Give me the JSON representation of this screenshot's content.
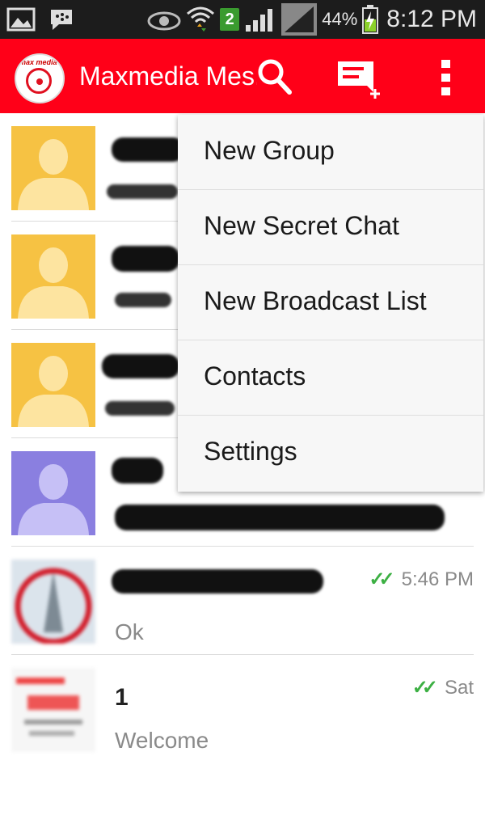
{
  "statusbar": {
    "badge": "2",
    "battery": "44%",
    "time": "8:12 PM"
  },
  "toolbar": {
    "title": "Maxmedia Mes...",
    "logo_text": "max media",
    "accent": "#ff0018"
  },
  "menu": {
    "items": [
      {
        "label": "New Group"
      },
      {
        "label": "New Secret Chat"
      },
      {
        "label": "New Broadcast List"
      },
      {
        "label": "Contacts"
      },
      {
        "label": "Settings"
      }
    ]
  },
  "chats": [
    {
      "name": "",
      "message": "",
      "time": "",
      "avatar": "yellow-silhouette"
    },
    {
      "name": "",
      "message": "",
      "time": "",
      "avatar": "yellow-silhouette"
    },
    {
      "name": "",
      "message": "",
      "time": "",
      "avatar": "yellow-silhouette"
    },
    {
      "name": "",
      "message": "",
      "time": "",
      "avatar": "purple-silhouette"
    },
    {
      "name": "",
      "message": "Ok",
      "time": "5:46 PM",
      "avatar": "photo"
    },
    {
      "name": "1",
      "message": "Welcome",
      "time": "Sat",
      "avatar": "photo"
    }
  ],
  "colors": {
    "read_ticks": "#3cb043",
    "avatar_yellow": "#f6c243",
    "avatar_purple": "#8a7fe0"
  }
}
